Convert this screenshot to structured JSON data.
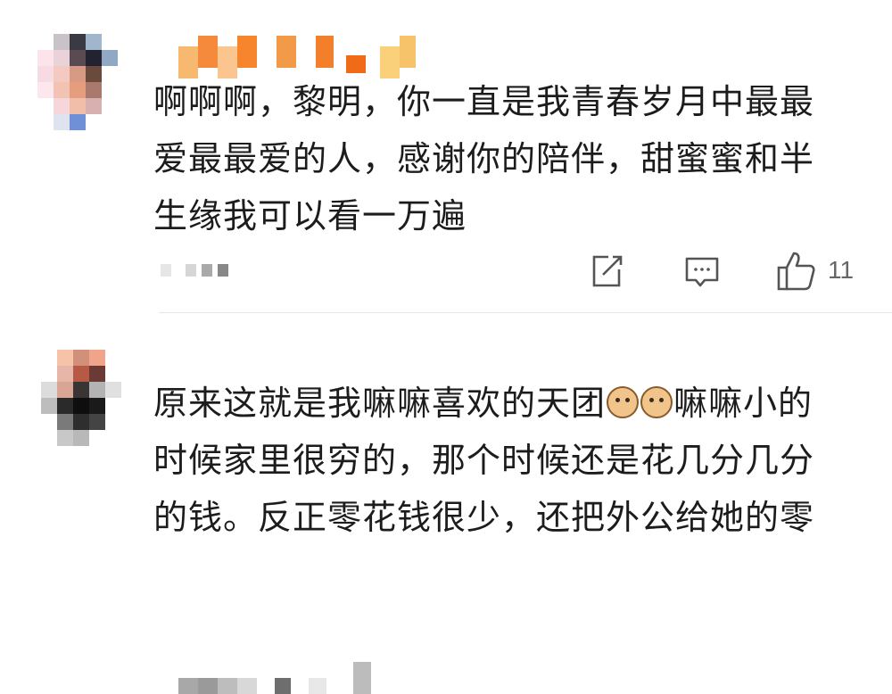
{
  "comments": [
    {
      "text_lines": [
        "啊啊啊，黎明，你一直是我青春岁月中最最",
        "爱最最爱的人，感谢你的陪伴，甜蜜蜜和半",
        "生缘我可以看一万遍"
      ],
      "actions": {
        "like_count": "11"
      },
      "icons": {
        "share": "share-edit-icon",
        "reply": "comment-icon",
        "like": "thumbs-up-icon"
      }
    },
    {
      "text_lines": {
        "line1_a": "原来这就是我嘛嘛喜欢的天团",
        "line1_b": "嘛嘛小的",
        "line2": "时候家里很穷的，那个时候还是花几分几分",
        "line3": "的钱。反正零花钱很少，还把外公给她的零"
      },
      "emoji": "cat-face-emoji"
    }
  ],
  "colors": {
    "text": "#1c1c1c",
    "icon": "#555555",
    "divider": "#e6e6e6"
  }
}
